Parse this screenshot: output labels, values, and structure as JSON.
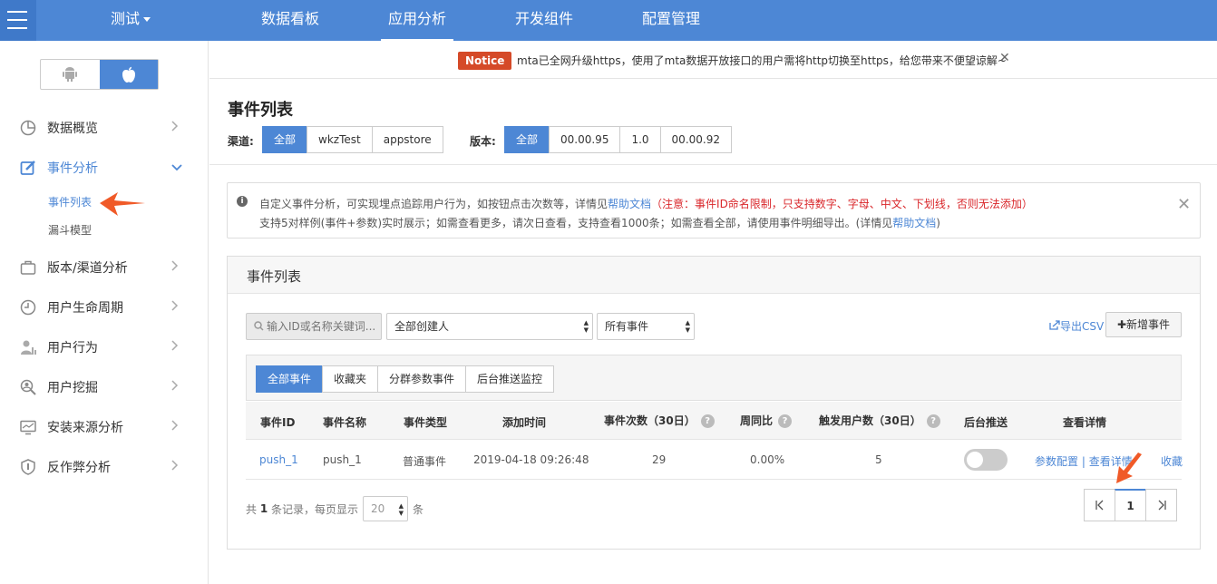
{
  "topbar": {
    "app_name": "测试",
    "nav": [
      "数据看板",
      "应用分析",
      "开发组件",
      "配置管理"
    ],
    "active_nav": "应用分析"
  },
  "sidebar": {
    "os_options": [
      "android",
      "apple"
    ],
    "active_os": "apple",
    "items": [
      {
        "label": "数据概览",
        "icon": "pie-chart-icon"
      },
      {
        "label": "事件分析",
        "icon": "edit-icon",
        "expanded": true
      },
      {
        "label": "版本/渠道分析",
        "icon": "briefcase-icon"
      },
      {
        "label": "用户生命周期",
        "icon": "clock-icon"
      },
      {
        "label": "用户行为",
        "icon": "user-icon"
      },
      {
        "label": "用户挖掘",
        "icon": "magnifier-icon"
      },
      {
        "label": "安装来源分析",
        "icon": "monitor-icon"
      },
      {
        "label": "反作弊分析",
        "icon": "shield-icon"
      }
    ],
    "sub_items": [
      "事件列表",
      "漏斗模型"
    ],
    "active_sub": "事件列表"
  },
  "notice": {
    "badge": "Notice",
    "text": "mta已全网升级https，使用了mta数据开放接口的用户需将http切换至https，给您带来不便望谅解~"
  },
  "page": {
    "title": "事件列表",
    "channel_label": "渠道:",
    "channels": [
      "全部",
      "wkzTest",
      "appstore"
    ],
    "active_channel": "全部",
    "version_label": "版本:",
    "versions": [
      "全部",
      "00.00.95",
      "1.0",
      "00.00.92"
    ],
    "active_version": "全部"
  },
  "info": {
    "line1_a": "自定义事件分析，可实现埋点追踪用户行为，如按钮点击次数等，详情见",
    "line1_link": "帮助文档",
    "line1_warn": "（注意：事件ID命名限制，只支持数字、字母、中文、下划线，否则无法添加）",
    "line2_a": "支持5对样例(事件+参数)实时展示；如需查看更多，请次日查看，支持查看1000条；如需查看全部，请使用事件明细导出。(详情见",
    "line2_link": "帮助文档",
    "line2_b": ")"
  },
  "panel": {
    "title": "事件列表",
    "search_placeholder": "输入ID或名称关键词...",
    "creator_select": "全部创建人",
    "event_select": "所有事件",
    "export_label": "导出CSV",
    "add_label": "✚新增事件",
    "tabs": [
      "全部事件",
      "收藏夹",
      "分群参数事件",
      "后台推送监控"
    ],
    "active_tab": "全部事件"
  },
  "table": {
    "headers": [
      "事件ID",
      "事件名称",
      "事件类型",
      "添加时间",
      "事件次数（30日）",
      "周同比",
      "触发用户数（30日）",
      "后台推送",
      "查看详情"
    ],
    "rows": [
      {
        "id": "push_1",
        "name": "push_1",
        "type": "普通事件",
        "added": "2019-04-18 09:26:48",
        "count": "29",
        "wow": "0.00%",
        "users": "5",
        "push_enabled": false,
        "action_config": "参数配置",
        "action_sep": "|",
        "action_detail": "查看详情",
        "action_fav": "收藏"
      }
    ]
  },
  "footer": {
    "prefix": "共",
    "total": "1",
    "mid": "条记录，每页显示",
    "page_size": "20",
    "suffix": "条",
    "current_page": "1"
  },
  "colors": {
    "accent": "#4d87d5",
    "notice_badge": "#d54a28",
    "warn_text": "#d9262a",
    "annotation_arrow": "#f05a28"
  }
}
